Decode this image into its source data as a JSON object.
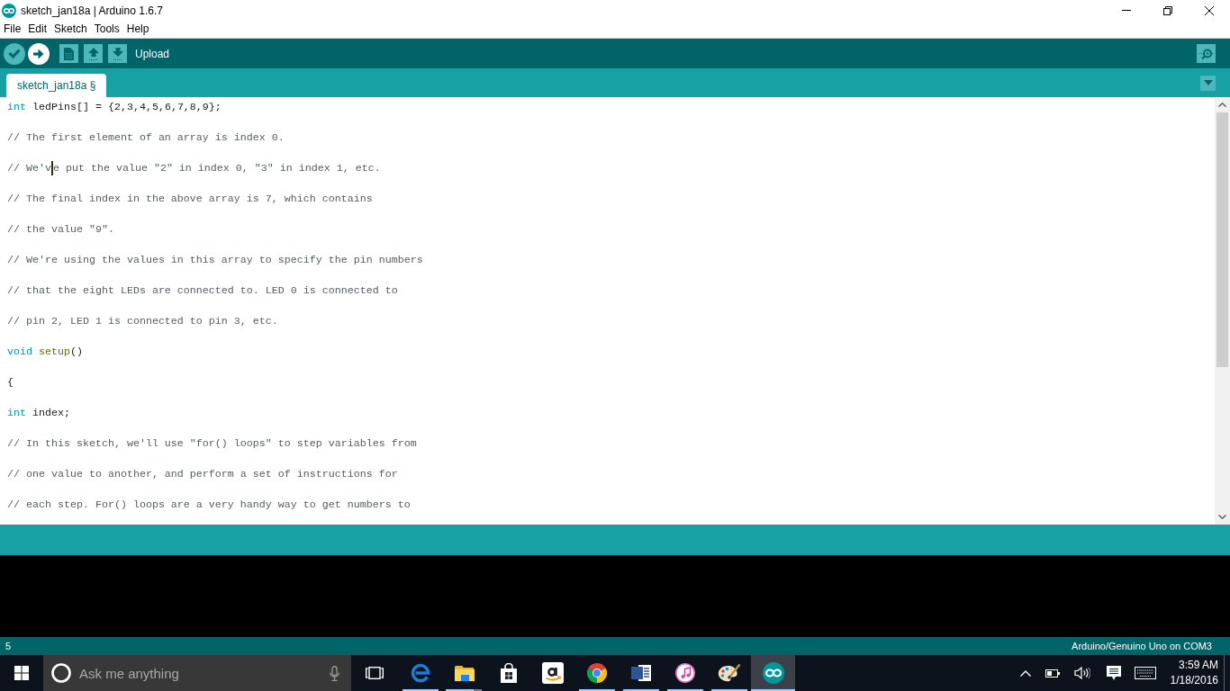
{
  "window": {
    "title": "sketch_jan18a | Arduino 1.6.7"
  },
  "menu": [
    "File",
    "Edit",
    "Sketch",
    "Tools",
    "Help"
  ],
  "toolbar": {
    "buttons": [
      {
        "kind": "verify",
        "hovered": false
      },
      {
        "kind": "upload",
        "hovered": true
      },
      {
        "kind": "new",
        "hovered": false
      },
      {
        "kind": "open",
        "hovered": false
      },
      {
        "kind": "save",
        "hovered": false
      }
    ],
    "hint": "Upload"
  },
  "tabs": [
    {
      "label": "sketch_jan18a §",
      "selected": true
    }
  ],
  "editor": {
    "lines": [
      {
        "tokens": [
          {
            "kind": "type",
            "text": "int"
          },
          {
            "kind": "plain",
            "text": " ledPins[] = {2,3,4,5,6,7,8,9};"
          }
        ]
      },
      {
        "tokens": [
          {
            "kind": "comment",
            "text": "// The first element of an array is index 0."
          }
        ]
      },
      {
        "tokens": [
          {
            "kind": "comment",
            "text": "// We'v"
          },
          {
            "kind": "caret"
          },
          {
            "kind": "comment",
            "text": "e put the value \"2\" in index 0, \"3\" in index 1, etc."
          }
        ]
      },
      {
        "tokens": [
          {
            "kind": "comment",
            "text": "// The final index in the above array is 7, which contains"
          }
        ]
      },
      {
        "tokens": [
          {
            "kind": "comment",
            "text": "// the value \"9\"."
          }
        ]
      },
      {
        "tokens": [
          {
            "kind": "comment",
            "text": "// We're using the values in this array to specify the pin numbers"
          }
        ]
      },
      {
        "tokens": [
          {
            "kind": "comment",
            "text": "// that the eight LEDs are connected to. LED 0 is connected to"
          }
        ]
      },
      {
        "tokens": [
          {
            "kind": "comment",
            "text": "// pin 2, LED 1 is connected to pin 3, etc."
          }
        ]
      },
      {
        "tokens": [
          {
            "kind": "type",
            "text": "void"
          },
          {
            "kind": "function",
            "text": " setup"
          },
          {
            "kind": "plain",
            "text": "()"
          }
        ]
      },
      {
        "tokens": [
          {
            "kind": "plain",
            "text": "{"
          }
        ]
      },
      {
        "tokens": [
          {
            "kind": "type",
            "text": "int"
          },
          {
            "kind": "plain",
            "text": " index;"
          }
        ]
      },
      {
        "tokens": [
          {
            "kind": "comment",
            "text": "// In this sketch, we'll use \"for() loops\" to step variables from"
          }
        ]
      },
      {
        "tokens": [
          {
            "kind": "comment",
            "text": "// one value to another, and perform a set of instructions for"
          }
        ]
      },
      {
        "tokens": [
          {
            "kind": "comment",
            "text": "// each step. For() loops are a very handy way to get numbers to"
          }
        ]
      }
    ]
  },
  "status_bar": {
    "line": "5",
    "board": "Arduino/Genuino Uno on COM3"
  },
  "taskbar": {
    "search": {
      "placeholder": "Ask me anything"
    },
    "apps": [
      {
        "kind": "edge",
        "running": true,
        "active": false,
        "stacked": false
      },
      {
        "kind": "folder",
        "running": true,
        "active": false,
        "stacked": true
      },
      {
        "kind": "store",
        "running": false,
        "active": false,
        "stacked": false
      },
      {
        "kind": "amazon",
        "running": false,
        "active": false,
        "stacked": false
      },
      {
        "kind": "chrome",
        "running": true,
        "active": false,
        "stacked": false
      },
      {
        "kind": "word",
        "running": true,
        "active": false,
        "stacked": false
      },
      {
        "kind": "music",
        "running": true,
        "active": false,
        "stacked": false
      },
      {
        "kind": "paint",
        "running": true,
        "active": false,
        "stacked": false
      },
      {
        "kind": "arduino",
        "running": true,
        "active": true,
        "stacked": false
      }
    ],
    "clock": {
      "time": "3:59 AM",
      "date": "1/18/2016"
    }
  }
}
